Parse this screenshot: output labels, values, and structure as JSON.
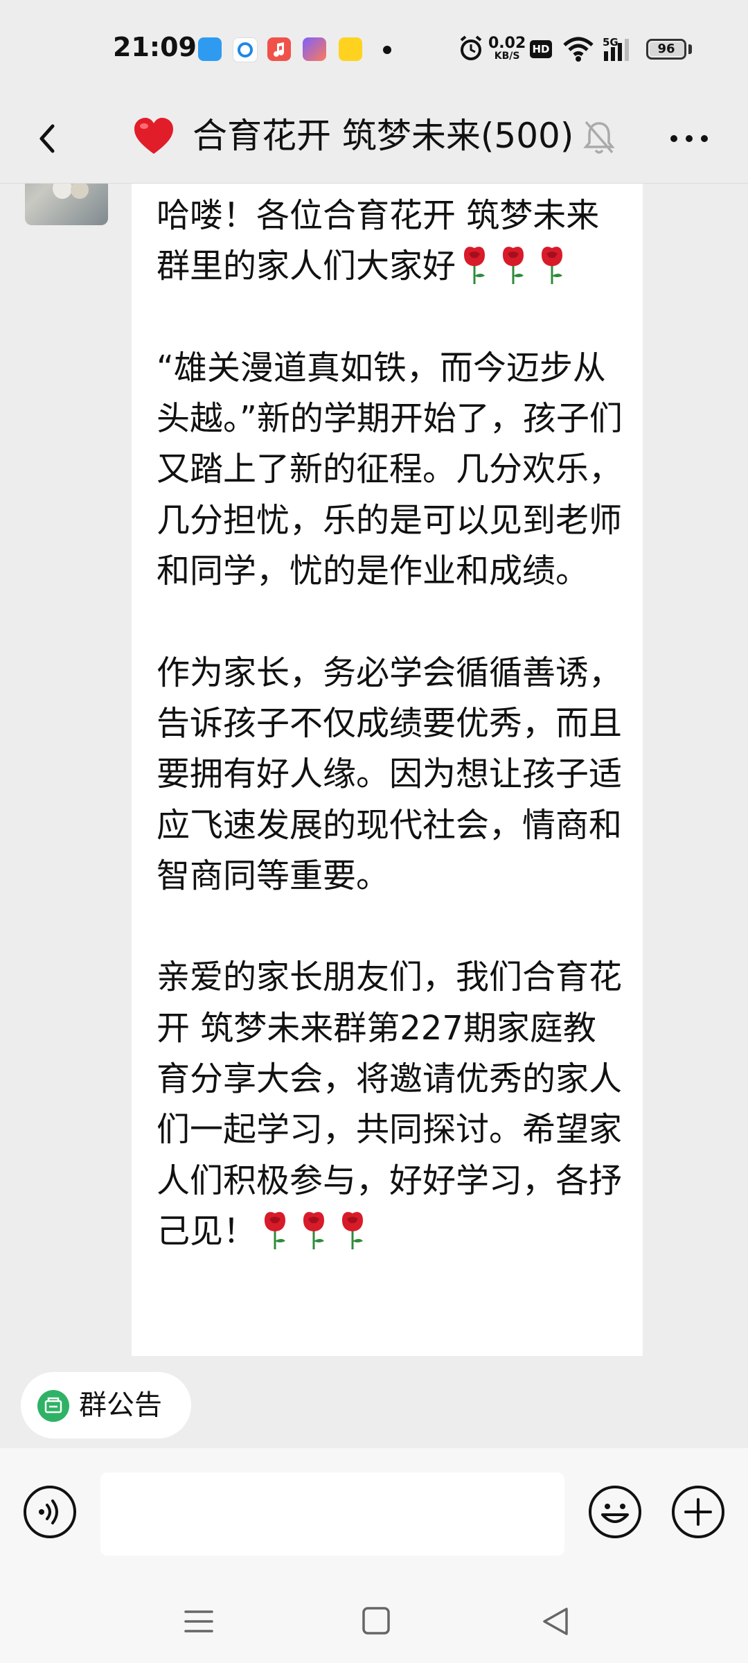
{
  "status_bar": {
    "time": "21:09",
    "app_icons": [
      "blue-app-icon",
      "qq-browser-icon",
      "music-app-icon",
      "shortcut-app-icon",
      "yellow-app-icon"
    ],
    "net_speed_value": "0.02",
    "net_speed_unit": "KB/S",
    "hd_badge": "HD",
    "signal_label": "5G",
    "battery_level": "96"
  },
  "header": {
    "back_icon": "chevron-left-icon",
    "heart_icon": "red-heart-emoji",
    "title": "合育花开 筑梦未来(500)",
    "mute_icon": "bell-muted-icon",
    "more_icon": "more-dots-icon"
  },
  "message": {
    "p1": "哈喽！各位合育花开 筑梦未来群里的家人们大家好",
    "p2": "“雄关漫道真如铁，而今迈步从头越。”新的学期开始了，孩子们又踏上了新的征程。几分欢乐，几分担忧，乐的是可以见到老师和同学，忧的是作业和成绩。",
    "p3": "作为家长，务必学会循循善诱，告诉孩子不仅成绩要优秀，而且要拥有好人缘。因为想让孩子适应飞速发展的现代社会，情商和智商同等重要。",
    "p4": "亲爱的家长朋友们，我们合育花开 筑梦未来群第227期家庭教育分享大会，将邀请优秀的家人们一起学习，共同探讨。希望家人们积极参与，好好学习，各抒己见！",
    "rose_icon": "rose-emoji"
  },
  "notice": {
    "label": "群公告",
    "icon": "notice-icon"
  },
  "input_bar": {
    "voice_icon": "voice-icon",
    "emoji_icon": "emoji-icon",
    "plus_icon": "plus-circle-icon"
  },
  "system_nav": {
    "menu_icon": "menu-icon",
    "home_icon": "home-square-icon",
    "back_icon": "back-triangle-icon"
  },
  "colors": {
    "background": "#ededed",
    "bubble": "#ffffff",
    "accent_green": "#2fb265",
    "rose": "#d81b2a"
  }
}
